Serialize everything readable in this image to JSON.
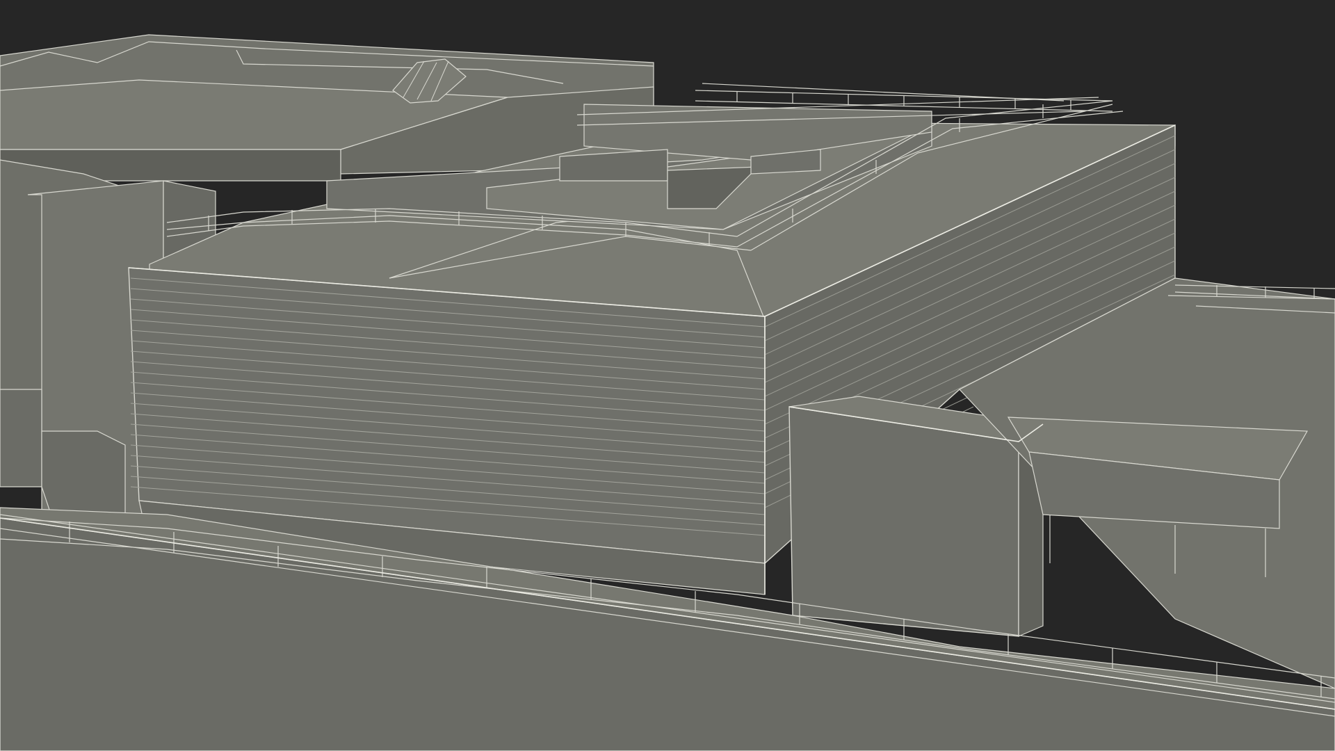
{
  "scene": {
    "subject": "wireframe-building-model",
    "colors": {
      "background": "#262626",
      "surface_light": "#7a7b73",
      "surface_mid": "#6f706a",
      "surface_dark": "#5f605a",
      "wire": "#d8d8d0"
    }
  }
}
